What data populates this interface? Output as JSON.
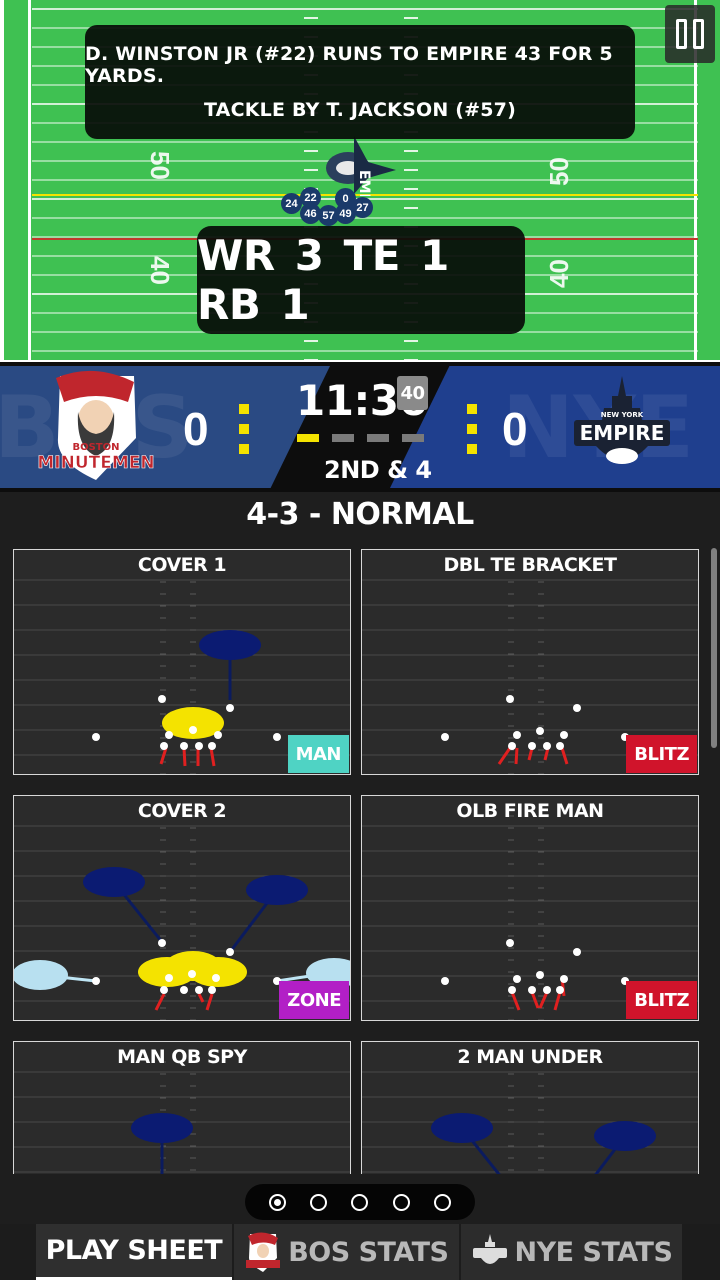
{
  "play_result": {
    "line1": "D. WINSTON JR (#22) RUNS TO EMPIRE 43 FOR 5 YARDS.",
    "line2": "TACKLE BY T. JACKSON (#57)"
  },
  "field": {
    "yard_numbers": [
      "50",
      "50",
      "40",
      "40"
    ],
    "players": [
      "24",
      "22",
      "46",
      "57",
      "0",
      "49",
      "27"
    ]
  },
  "personnel": "WR 3  TE 1  RB 1",
  "scoreboard": {
    "home_ghost": "BOS",
    "away_ghost": "NYE",
    "home_score": "0",
    "away_score": "0",
    "game_clock": "11:36",
    "play_clock": "40",
    "down_distance": "2ND & 4",
    "home_team_line1": "BOSTON",
    "home_team_line2": "MINUTEMEN",
    "away_team_line1": "NEW YORK",
    "away_team_line2": "EMPIRE",
    "colors": {
      "home": "#2a4a83",
      "away": "#1f3f8e",
      "timeouts": "#f4e300"
    }
  },
  "formation": "4-3 - NORMAL",
  "plays": [
    {
      "title": "COVER 1",
      "tag": "MAN"
    },
    {
      "title": "DBL TE BRACKET",
      "tag": "BLITZ"
    },
    {
      "title": "COVER 2",
      "tag": "ZONE"
    },
    {
      "title": "OLB FIRE MAN",
      "tag": "BLITZ"
    },
    {
      "title": "MAN QB SPY",
      "tag": ""
    },
    {
      "title": "2 MAN UNDER",
      "tag": ""
    }
  ],
  "pager": {
    "pages": 5,
    "active": 0
  },
  "tabs": {
    "play_sheet": "PLAY SHEET",
    "bos_stats": "BOS STATS",
    "nye_stats": "NYE STATS"
  },
  "icons": [
    "pause-icon",
    "boston-minutemen-logo",
    "new-york-empire-logo"
  ]
}
